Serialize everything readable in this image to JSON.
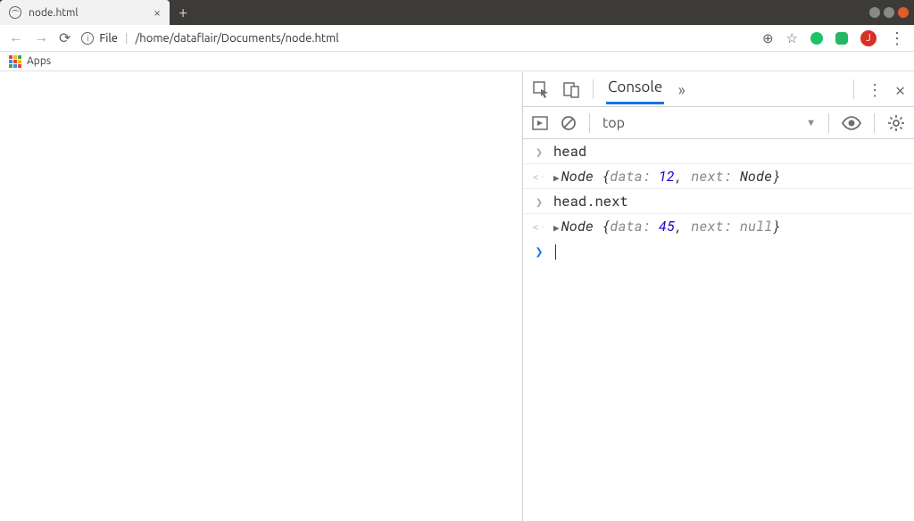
{
  "browser": {
    "tab_title": "node.html",
    "url_scheme_label": "File",
    "url_path": "/home/dataflair/Documents/node.html",
    "apps_label": "Apps",
    "avatar_letter": "J"
  },
  "devtools": {
    "panel": "Console",
    "context": "top",
    "entries": [
      {
        "kind": "input",
        "code": "head"
      },
      {
        "kind": "result",
        "class": "Node",
        "props": [
          {
            "name": "data",
            "value": "12",
            "type": "number"
          },
          {
            "name": "next",
            "value": "Node",
            "type": "object"
          }
        ]
      },
      {
        "kind": "input",
        "code": "head.next"
      },
      {
        "kind": "result",
        "class": "Node",
        "props": [
          {
            "name": "data",
            "value": "45",
            "type": "number"
          },
          {
            "name": "next",
            "value": "null",
            "type": "null"
          }
        ]
      }
    ]
  }
}
